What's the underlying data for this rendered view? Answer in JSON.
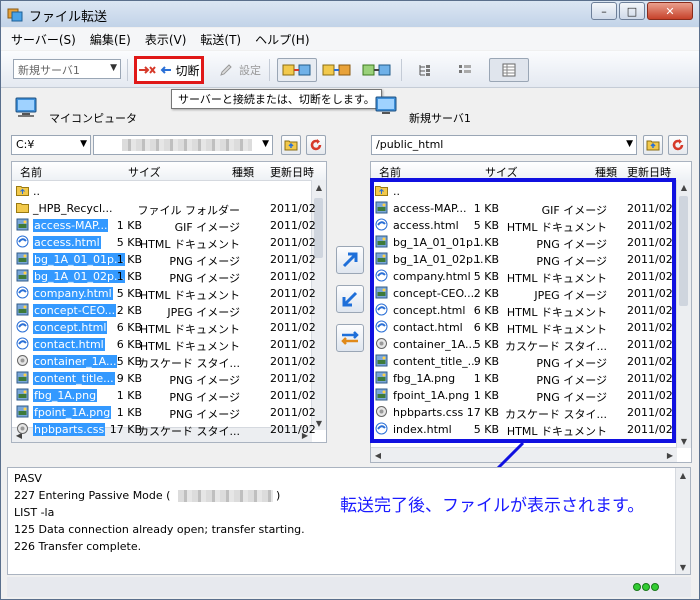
{
  "window": {
    "title": "ファイル転送",
    "controls": {
      "minimize": "–",
      "maximize": "□",
      "close": "✕"
    }
  },
  "menu": [
    {
      "label": "サーバー(S)"
    },
    {
      "label": "編集(E)"
    },
    {
      "label": "表示(V)"
    },
    {
      "label": "転送(T)"
    },
    {
      "label": "ヘルプ(H)"
    }
  ],
  "toolbar": {
    "server_select": "新規サーバ1",
    "disconnect_label": "切断",
    "settings_label": "設定",
    "tooltip": "サーバーと接続または、切断をします。"
  },
  "local": {
    "title": "マイコンピュータ",
    "path": "C:¥",
    "columns": {
      "name": "名前",
      "size": "サイズ",
      "type": "種類",
      "date": "更新日時"
    },
    "rows": [
      {
        "icon": "up-folder-icon",
        "name": "..",
        "size": "",
        "type": "",
        "date": "",
        "selected": false
      },
      {
        "icon": "folder-icon",
        "name": "_HPB_Recycl...",
        "size": "",
        "type": "ファイル フォルダー",
        "date": "2011/02",
        "selected": false
      },
      {
        "icon": "image-file-icon",
        "name": "access-MAP...",
        "size": "1 KB",
        "type": "GIF イメージ",
        "date": "2011/02",
        "selected": true
      },
      {
        "icon": "html-file-icon",
        "name": "access.html",
        "size": "5 KB",
        "type": "HTML ドキュメント",
        "date": "2011/02",
        "selected": true
      },
      {
        "icon": "image-file-icon",
        "name": "bg_1A_01_01p...",
        "size": "1 KB",
        "type": "PNG イメージ",
        "date": "2011/02",
        "selected": true
      },
      {
        "icon": "image-file-icon",
        "name": "bg_1A_01_02p...",
        "size": "1 KB",
        "type": "PNG イメージ",
        "date": "2011/02",
        "selected": true
      },
      {
        "icon": "html-file-icon",
        "name": "company.html",
        "size": "5 KB",
        "type": "HTML ドキュメント",
        "date": "2011/02",
        "selected": true
      },
      {
        "icon": "image-file-icon",
        "name": "concept-CEO...",
        "size": "2 KB",
        "type": "JPEG イメージ",
        "date": "2011/02",
        "selected": true
      },
      {
        "icon": "html-file-icon",
        "name": "concept.html",
        "size": "6 KB",
        "type": "HTML ドキュメント",
        "date": "2011/02",
        "selected": true
      },
      {
        "icon": "html-file-icon",
        "name": "contact.html",
        "size": "6 KB",
        "type": "HTML ドキュメント",
        "date": "2011/02",
        "selected": true
      },
      {
        "icon": "css-file-icon",
        "name": "container_1A...",
        "size": "5 KB",
        "type": "カスケード スタイ...",
        "date": "2011/02",
        "selected": true
      },
      {
        "icon": "image-file-icon",
        "name": "content_title...",
        "size": "9 KB",
        "type": "PNG イメージ",
        "date": "2011/02",
        "selected": true
      },
      {
        "icon": "image-file-icon",
        "name": "fbg_1A.png",
        "size": "1 KB",
        "type": "PNG イメージ",
        "date": "2011/02",
        "selected": true
      },
      {
        "icon": "image-file-icon",
        "name": "fpoint_1A.png",
        "size": "1 KB",
        "type": "PNG イメージ",
        "date": "2011/02",
        "selected": true
      },
      {
        "icon": "css-file-icon",
        "name": "hpbparts.css",
        "size": "17 KB",
        "type": "カスケード スタイ...",
        "date": "2011/02",
        "selected": true
      }
    ]
  },
  "remote": {
    "title": "新規サーバ1",
    "path": "/public_html",
    "columns": {
      "name": "名前",
      "size": "サイズ",
      "type": "種類",
      "date": "更新日時"
    },
    "rows": [
      {
        "icon": "up-folder-icon",
        "name": "..",
        "size": "",
        "type": "",
        "date": ""
      },
      {
        "icon": "image-file-icon",
        "name": "access-MAP...",
        "size": "1 KB",
        "type": "GIF イメージ",
        "date": "2011/02"
      },
      {
        "icon": "html-file-icon",
        "name": "access.html",
        "size": "5 KB",
        "type": "HTML ドキュメント",
        "date": "2011/02"
      },
      {
        "icon": "image-file-icon",
        "name": "bg_1A_01_01p...",
        "size": "1 KB",
        "type": "PNG イメージ",
        "date": "2011/02"
      },
      {
        "icon": "image-file-icon",
        "name": "bg_1A_01_02p...",
        "size": "1 KB",
        "type": "PNG イメージ",
        "date": "2011/02"
      },
      {
        "icon": "html-file-icon",
        "name": "company.html",
        "size": "5 KB",
        "type": "HTML ドキュメント",
        "date": "2011/02"
      },
      {
        "icon": "image-file-icon",
        "name": "concept-CEO...",
        "size": "2 KB",
        "type": "JPEG イメージ",
        "date": "2011/02"
      },
      {
        "icon": "html-file-icon",
        "name": "concept.html",
        "size": "6 KB",
        "type": "HTML ドキュメント",
        "date": "2011/02"
      },
      {
        "icon": "html-file-icon",
        "name": "contact.html",
        "size": "6 KB",
        "type": "HTML ドキュメント",
        "date": "2011/02"
      },
      {
        "icon": "css-file-icon",
        "name": "container_1A...",
        "size": "5 KB",
        "type": "カスケード スタイ...",
        "date": "2011/02"
      },
      {
        "icon": "image-file-icon",
        "name": "content_title_...",
        "size": "9 KB",
        "type": "PNG イメージ",
        "date": "2011/02"
      },
      {
        "icon": "image-file-icon",
        "name": "fbg_1A.png",
        "size": "1 KB",
        "type": "PNG イメージ",
        "date": "2011/02"
      },
      {
        "icon": "image-file-icon",
        "name": "fpoint_1A.png",
        "size": "1 KB",
        "type": "PNG イメージ",
        "date": "2011/02"
      },
      {
        "icon": "css-file-icon",
        "name": "hpbparts.css",
        "size": "17 KB",
        "type": "カスケード スタイ...",
        "date": "2011/02"
      },
      {
        "icon": "html-file-icon",
        "name": "index.html",
        "size": "5 KB",
        "type": "HTML ドキュメント",
        "date": "2011/02"
      }
    ]
  },
  "log": [
    "PASV",
    "227  Entering Passive Mode (",
    "LIST -la",
    "125  Data connection already open; transfer starting.",
    "226  Transfer complete."
  ],
  "annotation": "転送完了後、ファイルが表示されます。",
  "colors": {
    "highlight_red": "#e01818",
    "highlight_blue": "#1010e0",
    "selection": "#3399ff"
  }
}
